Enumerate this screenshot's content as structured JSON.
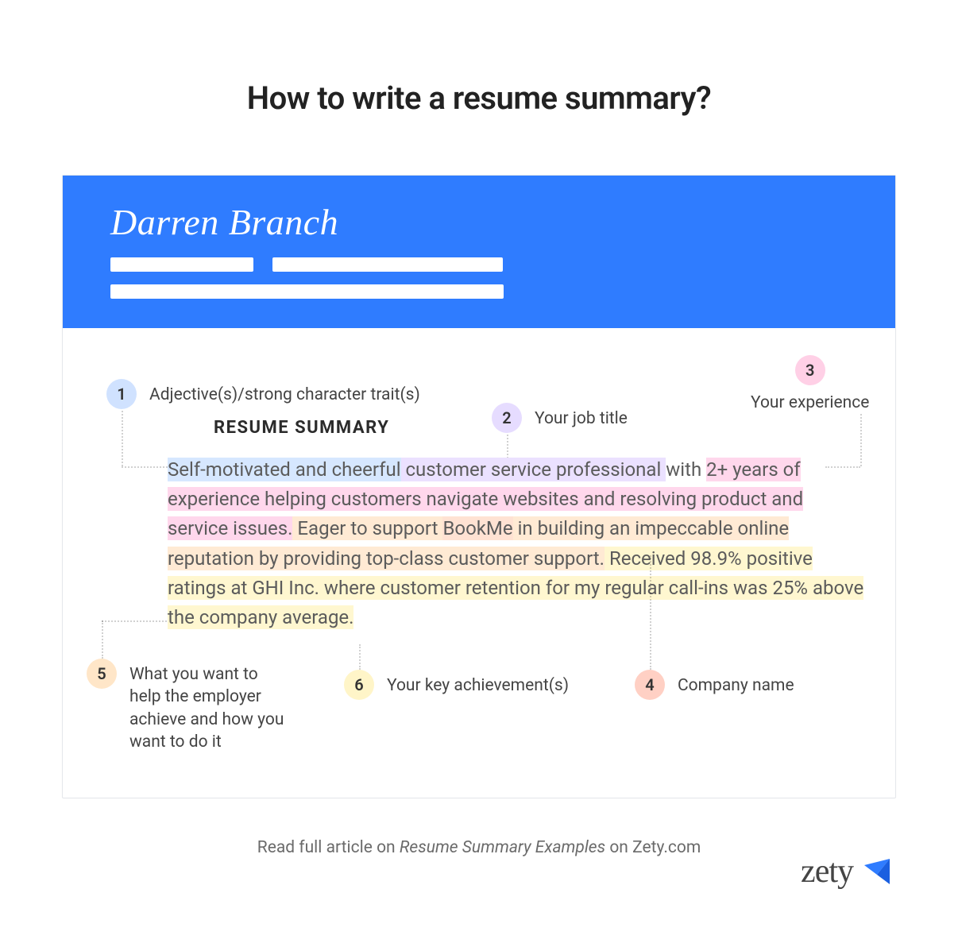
{
  "title": "How to write a resume summary?",
  "resume_name": "Darren Branch",
  "section_heading": "RESUME SUMMARY",
  "annotations": {
    "a1": {
      "num": "1",
      "label": "Adjective(s)/strong character trait(s)"
    },
    "a2": {
      "num": "2",
      "label": "Your job title"
    },
    "a3": {
      "num": "3",
      "label": "Your experience"
    },
    "a4": {
      "num": "4",
      "label": "Company name"
    },
    "a5": {
      "num": "5",
      "label": "What you want to help the employer achieve and how you want to do it"
    },
    "a6": {
      "num": "6",
      "label": "Your key achievement(s)"
    }
  },
  "body": {
    "seg1": "Self-motivated and cheerful",
    "seg2": " customer service professional ",
    "seg3_a": "with ",
    "seg3_b": "2+ years of experience helping customers navigate websites and resolving product and service issues.",
    "seg4_a": " Eager to support ",
    "seg4_b": "BookMe",
    "seg4_c": " in building an impeccable online reputation by providing top-class customer support.",
    "seg5": " Received 98.9% positive ratings at GHI Inc. where customer retention for my regular call-ins was 25% above the company average."
  },
  "footer": {
    "prefix": "Read full article on ",
    "link": "Resume Summary Examples",
    "suffix": " on Zety.com"
  },
  "brand": "zety"
}
